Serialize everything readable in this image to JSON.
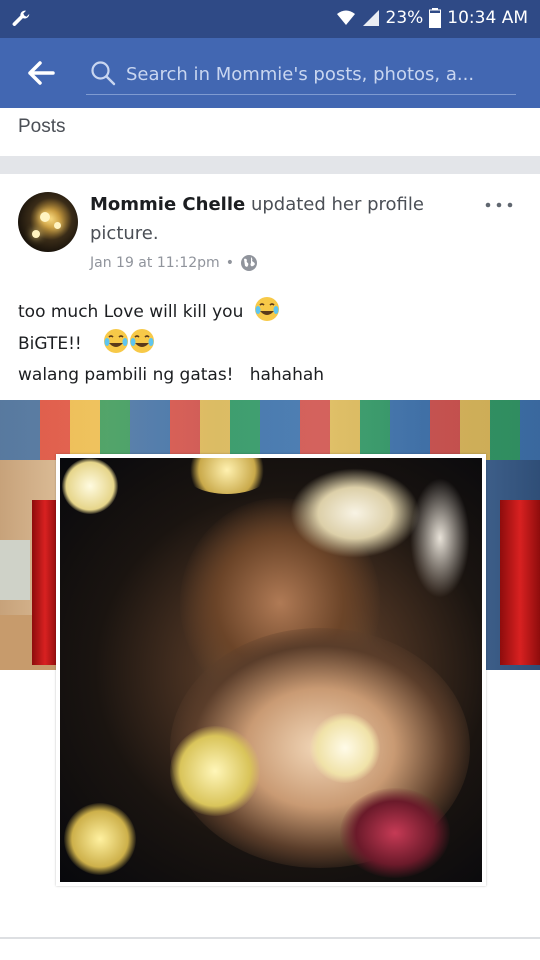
{
  "status_bar": {
    "battery": "23%",
    "time": "10:34 AM"
  },
  "search": {
    "placeholder": "Search in Mommie's posts, photos, a..."
  },
  "section": {
    "title": "Posts"
  },
  "post": {
    "author": "Mommie Chelle",
    "action": " updated her profile picture.",
    "timestamp": "Jan 19 at 11:12pm",
    "privacy_separator": "•",
    "text_lines": [
      "too much Love will kill you",
      "BiGTE!!",
      "walang pambili ng gatas!   hahahah"
    ],
    "more_icon": "more-options-icon"
  },
  "icons": {
    "status_left": "wrench-icon",
    "back": "back-arrow-icon",
    "search": "search-icon",
    "privacy": "globe-icon",
    "emoji": "tears-of-joy-emoji"
  },
  "colors": {
    "status_bar": "#2f4a86",
    "header": "#4267b2",
    "divider": "#e3e5e9"
  }
}
